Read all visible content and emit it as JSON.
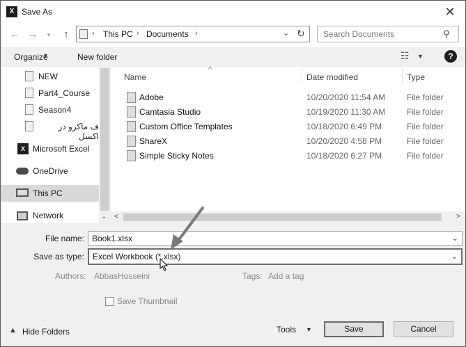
{
  "window": {
    "title": "Save As",
    "app_icon": "X"
  },
  "address": {
    "items": [
      "This PC",
      "Documents"
    ],
    "separator": "›"
  },
  "search": {
    "placeholder": "Search Documents"
  },
  "toolbar": {
    "organize": "Organize",
    "new_folder": "New folder",
    "help": "?"
  },
  "nav": {
    "items": [
      {
        "label": "NEW",
        "icon": "folder-doc-icon"
      },
      {
        "label": "Part4_Course",
        "icon": "folder-doc-icon"
      },
      {
        "label": "Season4",
        "icon": "folder-doc-icon"
      },
      {
        "label": "ف ماکرو در اکسل",
        "icon": "folder-doc-icon"
      },
      {
        "label": "Microsoft Excel",
        "icon": "excel-icon"
      },
      {
        "label": "OneDrive",
        "icon": "cloud-icon"
      },
      {
        "label": "This PC",
        "icon": "computer-icon",
        "selected": true
      },
      {
        "label": "Network",
        "icon": "network-icon"
      }
    ]
  },
  "list": {
    "columns": {
      "name": "Name",
      "date": "Date modified",
      "type": "Type"
    },
    "rows": [
      {
        "name": "Adobe",
        "date": "10/20/2020 11:54 AM",
        "type": "File folder"
      },
      {
        "name": "Camtasia Studio",
        "date": "10/19/2020 11:30 AM",
        "type": "File folder"
      },
      {
        "name": "Custom Office Templates",
        "date": "10/18/2020 6:49 PM",
        "type": "File folder"
      },
      {
        "name": "ShareX",
        "date": "10/20/2020 4:58 PM",
        "type": "File folder"
      },
      {
        "name": "Simple Sticky Notes",
        "date": "10/18/2020 6:27 PM",
        "type": "File folder"
      }
    ]
  },
  "form": {
    "file_name_label": "File name:",
    "file_name_value": "Book1.xlsx",
    "save_type_label": "Save as type:",
    "save_type_value": "Excel Workbook (*.xlsx)",
    "authors_label": "Authors:",
    "authors_value": "AbbasHosseini",
    "tags_label": "Tags:",
    "tags_value": "Add a tag",
    "thumbnail_label": "Save Thumbnail"
  },
  "footer": {
    "hide_folders": "Hide Folders",
    "tools": "Tools",
    "save": "Save",
    "cancel": "Cancel"
  }
}
